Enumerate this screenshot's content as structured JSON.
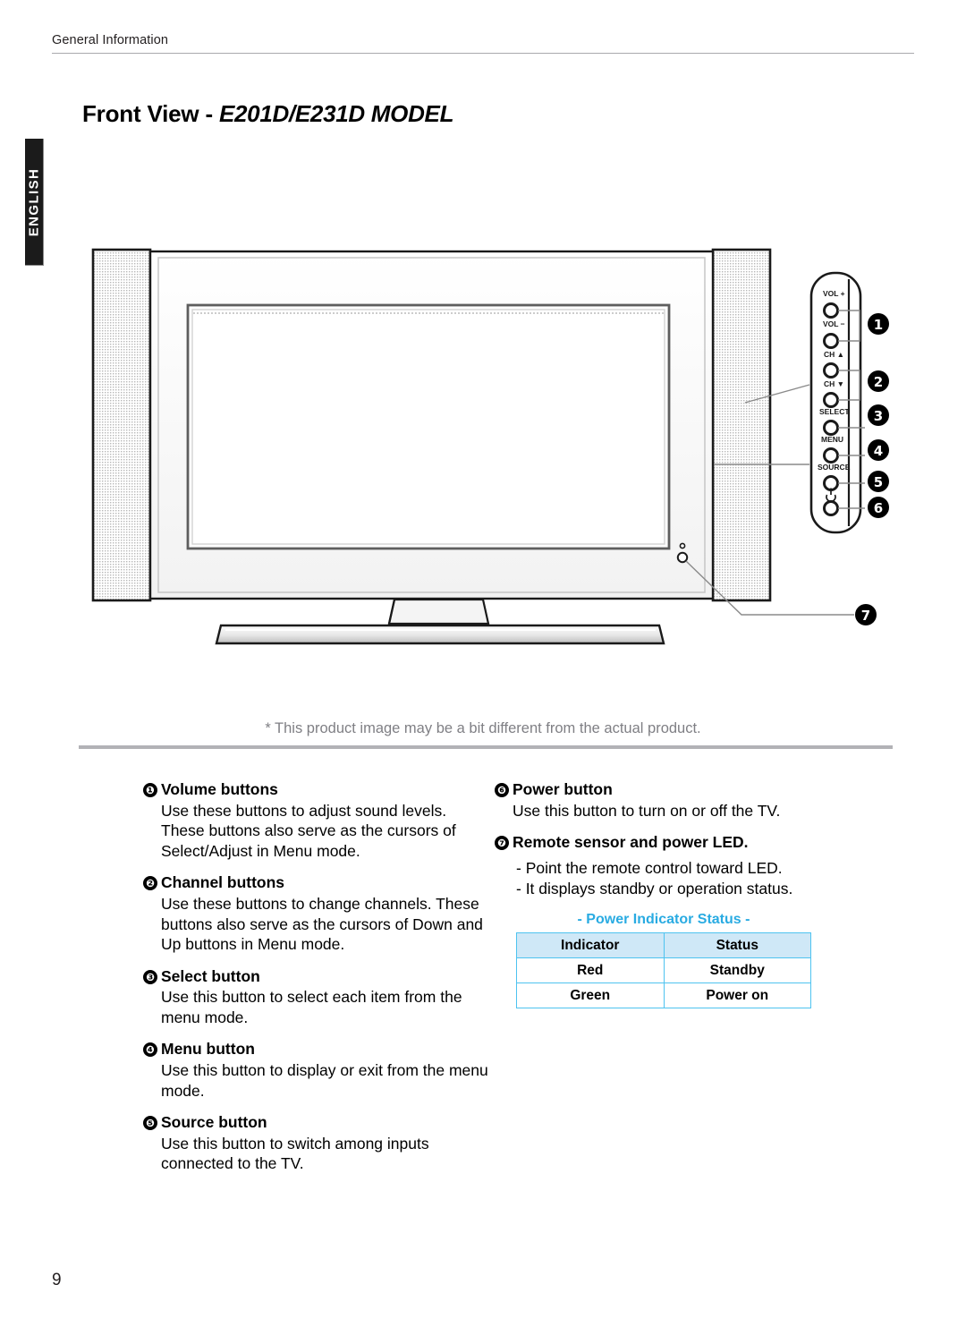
{
  "header": {
    "running_head": "General Information"
  },
  "language_tab": {
    "label": "ENGLISH"
  },
  "title": {
    "main": "Front View",
    "separator": " - ",
    "model": "E201D/E231D MODEL"
  },
  "figure": {
    "note": "* This product image may be a bit different from the actual product.",
    "panel_labels": {
      "vol_up": "VOL +",
      "vol_down": "VOL −",
      "ch_up": "CH ▲",
      "ch_down": "CH ▼",
      "select": "SELECT",
      "menu": "MENU",
      "source": "SOURCE",
      "power": "⏻"
    },
    "callouts": [
      "1",
      "2",
      "3",
      "4",
      "5",
      "6",
      "7"
    ]
  },
  "descriptions": {
    "left": [
      {
        "num": "❶",
        "heading": "Volume buttons",
        "lines": [
          "Use these buttons to adjust sound levels.",
          "These buttons also serve as the cursors of",
          "Select/Adjust in Menu mode."
        ]
      },
      {
        "num": "❷",
        "heading": "Channel buttons",
        "lines": [
          "Use these buttons to change channels. These",
          "buttons also serve as the cursors of Down and",
          "Up buttons in Menu mode."
        ]
      },
      {
        "num": "❸",
        "heading": "Select button",
        "lines": [
          "Use this button to select each item from the",
          "menu mode."
        ]
      },
      {
        "num": "❹",
        "heading": "Menu button",
        "lines": [
          "Use this button to display or exit from the menu",
          "mode."
        ]
      },
      {
        "num": "❺",
        "heading": "Source button",
        "lines": [
          "Use this button to switch among inputs",
          "connected to the TV."
        ]
      }
    ],
    "right": [
      {
        "num": "❻",
        "heading": "Power button",
        "lines": [
          "Use this button to turn on or off the TV."
        ]
      },
      {
        "num": "❼",
        "heading": "Remote sensor and power LED.",
        "dash_lines": [
          "- Point the remote control toward LED.",
          "- It displays standby or operation status."
        ]
      }
    ]
  },
  "power_indicator_table": {
    "title": "- Power Indicator Status -",
    "columns": [
      "Indicator",
      "Status"
    ],
    "rows": [
      [
        "Red",
        "Standby"
      ],
      [
        "Green",
        "Power on"
      ]
    ]
  },
  "footer": {
    "page_number": "9"
  },
  "colors": {
    "accent_cyan": "#29abe2",
    "table_header_fill": "#cfe8f7",
    "table_border": "#4ec3f0",
    "note_gray": "#7f7f84",
    "tab_black": "#1b1b1b"
  }
}
